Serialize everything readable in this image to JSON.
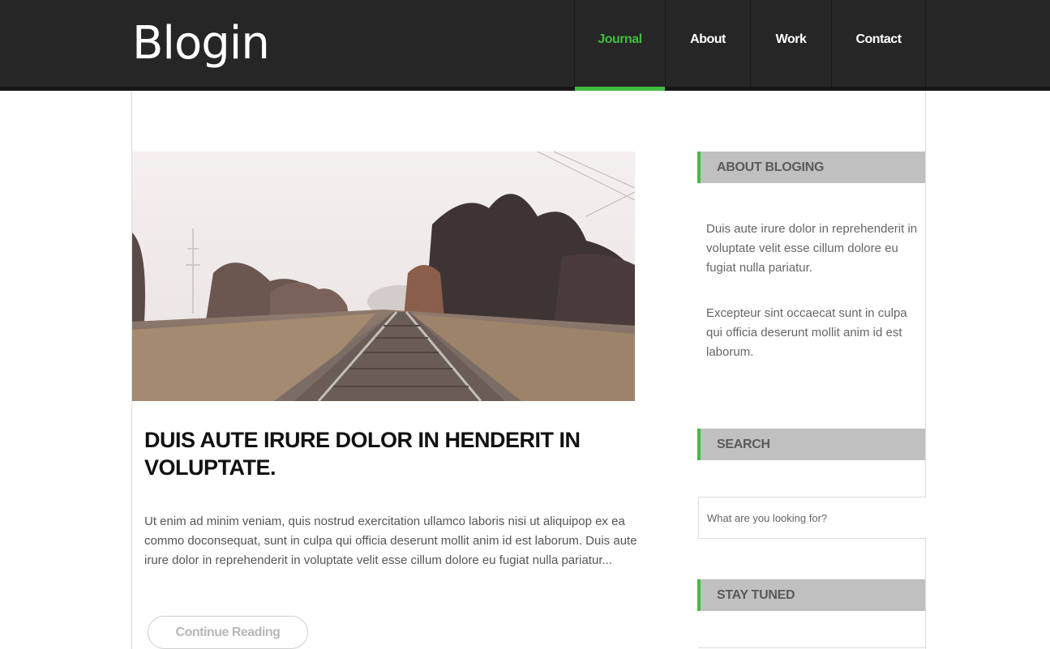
{
  "header": {
    "logo": "Blogin",
    "nav": [
      {
        "label": "Journal",
        "active": true
      },
      {
        "label": "About",
        "active": false
      },
      {
        "label": "Work",
        "active": false
      },
      {
        "label": "Contact",
        "active": false
      }
    ]
  },
  "post": {
    "title": "DUIS AUTE IRURE DOLOR IN HENDERIT IN VOLUPTATE.",
    "excerpt": "Ut enim ad minim veniam, quis nostrud exercitation ullamco laboris nisi ut aliquipop ex ea commo doconsequat, sunt in culpa qui officia deserunt mollit anim id est laborum. Duis aute irure dolor in reprehenderit in voluptate velit esse cillum dolore eu fugiat nulla pariatur...",
    "continue_label": "Continue Reading"
  },
  "sidebar": {
    "about_title": "ABOUT BLOGING",
    "about_p1": "Duis aute irure dolor in reprehenderit in voluptate velit esse cillum dolore eu fugiat nulla pariatur.",
    "about_p2": "Excepteur sint occaecat sunt in culpa qui officia deserunt mollit anim id est laborum.",
    "search_title": "SEARCH",
    "search_placeholder": "What are you looking for?",
    "stay_title": "STAY TUNED"
  },
  "colors": {
    "accent": "#3fbe3f",
    "header_bg": "#262626",
    "widget_bg": "#c0c0c0"
  }
}
